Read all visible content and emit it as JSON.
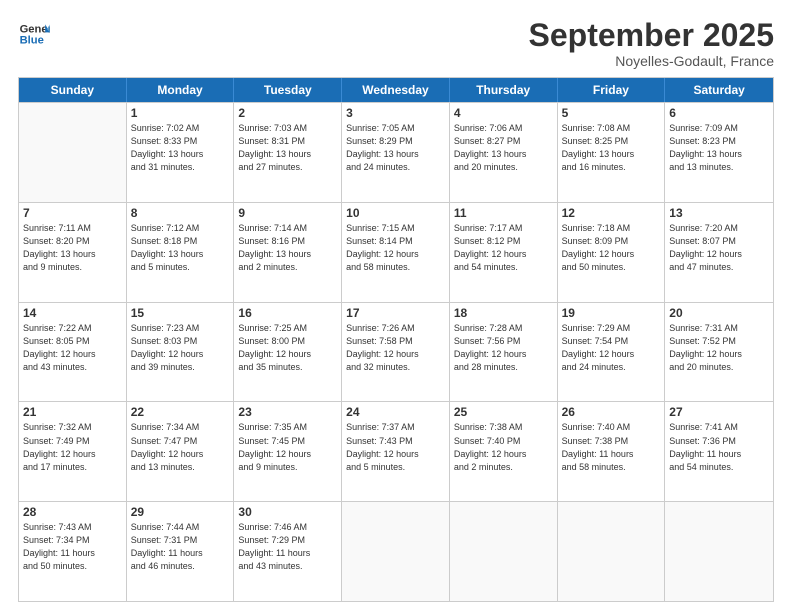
{
  "logo": {
    "line1": "General",
    "line2": "Blue"
  },
  "title": "September 2025",
  "location": "Noyelles-Godault, France",
  "days_of_week": [
    "Sunday",
    "Monday",
    "Tuesday",
    "Wednesday",
    "Thursday",
    "Friday",
    "Saturday"
  ],
  "weeks": [
    [
      {
        "day": "",
        "info": ""
      },
      {
        "day": "1",
        "info": "Sunrise: 7:02 AM\nSunset: 8:33 PM\nDaylight: 13 hours\nand 31 minutes."
      },
      {
        "day": "2",
        "info": "Sunrise: 7:03 AM\nSunset: 8:31 PM\nDaylight: 13 hours\nand 27 minutes."
      },
      {
        "day": "3",
        "info": "Sunrise: 7:05 AM\nSunset: 8:29 PM\nDaylight: 13 hours\nand 24 minutes."
      },
      {
        "day": "4",
        "info": "Sunrise: 7:06 AM\nSunset: 8:27 PM\nDaylight: 13 hours\nand 20 minutes."
      },
      {
        "day": "5",
        "info": "Sunrise: 7:08 AM\nSunset: 8:25 PM\nDaylight: 13 hours\nand 16 minutes."
      },
      {
        "day": "6",
        "info": "Sunrise: 7:09 AM\nSunset: 8:23 PM\nDaylight: 13 hours\nand 13 minutes."
      }
    ],
    [
      {
        "day": "7",
        "info": "Sunrise: 7:11 AM\nSunset: 8:20 PM\nDaylight: 13 hours\nand 9 minutes."
      },
      {
        "day": "8",
        "info": "Sunrise: 7:12 AM\nSunset: 8:18 PM\nDaylight: 13 hours\nand 5 minutes."
      },
      {
        "day": "9",
        "info": "Sunrise: 7:14 AM\nSunset: 8:16 PM\nDaylight: 13 hours\nand 2 minutes."
      },
      {
        "day": "10",
        "info": "Sunrise: 7:15 AM\nSunset: 8:14 PM\nDaylight: 12 hours\nand 58 minutes."
      },
      {
        "day": "11",
        "info": "Sunrise: 7:17 AM\nSunset: 8:12 PM\nDaylight: 12 hours\nand 54 minutes."
      },
      {
        "day": "12",
        "info": "Sunrise: 7:18 AM\nSunset: 8:09 PM\nDaylight: 12 hours\nand 50 minutes."
      },
      {
        "day": "13",
        "info": "Sunrise: 7:20 AM\nSunset: 8:07 PM\nDaylight: 12 hours\nand 47 minutes."
      }
    ],
    [
      {
        "day": "14",
        "info": "Sunrise: 7:22 AM\nSunset: 8:05 PM\nDaylight: 12 hours\nand 43 minutes."
      },
      {
        "day": "15",
        "info": "Sunrise: 7:23 AM\nSunset: 8:03 PM\nDaylight: 12 hours\nand 39 minutes."
      },
      {
        "day": "16",
        "info": "Sunrise: 7:25 AM\nSunset: 8:00 PM\nDaylight: 12 hours\nand 35 minutes."
      },
      {
        "day": "17",
        "info": "Sunrise: 7:26 AM\nSunset: 7:58 PM\nDaylight: 12 hours\nand 32 minutes."
      },
      {
        "day": "18",
        "info": "Sunrise: 7:28 AM\nSunset: 7:56 PM\nDaylight: 12 hours\nand 28 minutes."
      },
      {
        "day": "19",
        "info": "Sunrise: 7:29 AM\nSunset: 7:54 PM\nDaylight: 12 hours\nand 24 minutes."
      },
      {
        "day": "20",
        "info": "Sunrise: 7:31 AM\nSunset: 7:52 PM\nDaylight: 12 hours\nand 20 minutes."
      }
    ],
    [
      {
        "day": "21",
        "info": "Sunrise: 7:32 AM\nSunset: 7:49 PM\nDaylight: 12 hours\nand 17 minutes."
      },
      {
        "day": "22",
        "info": "Sunrise: 7:34 AM\nSunset: 7:47 PM\nDaylight: 12 hours\nand 13 minutes."
      },
      {
        "day": "23",
        "info": "Sunrise: 7:35 AM\nSunset: 7:45 PM\nDaylight: 12 hours\nand 9 minutes."
      },
      {
        "day": "24",
        "info": "Sunrise: 7:37 AM\nSunset: 7:43 PM\nDaylight: 12 hours\nand 5 minutes."
      },
      {
        "day": "25",
        "info": "Sunrise: 7:38 AM\nSunset: 7:40 PM\nDaylight: 12 hours\nand 2 minutes."
      },
      {
        "day": "26",
        "info": "Sunrise: 7:40 AM\nSunset: 7:38 PM\nDaylight: 11 hours\nand 58 minutes."
      },
      {
        "day": "27",
        "info": "Sunrise: 7:41 AM\nSunset: 7:36 PM\nDaylight: 11 hours\nand 54 minutes."
      }
    ],
    [
      {
        "day": "28",
        "info": "Sunrise: 7:43 AM\nSunset: 7:34 PM\nDaylight: 11 hours\nand 50 minutes."
      },
      {
        "day": "29",
        "info": "Sunrise: 7:44 AM\nSunset: 7:31 PM\nDaylight: 11 hours\nand 46 minutes."
      },
      {
        "day": "30",
        "info": "Sunrise: 7:46 AM\nSunset: 7:29 PM\nDaylight: 11 hours\nand 43 minutes."
      },
      {
        "day": "",
        "info": ""
      },
      {
        "day": "",
        "info": ""
      },
      {
        "day": "",
        "info": ""
      },
      {
        "day": "",
        "info": ""
      }
    ]
  ]
}
